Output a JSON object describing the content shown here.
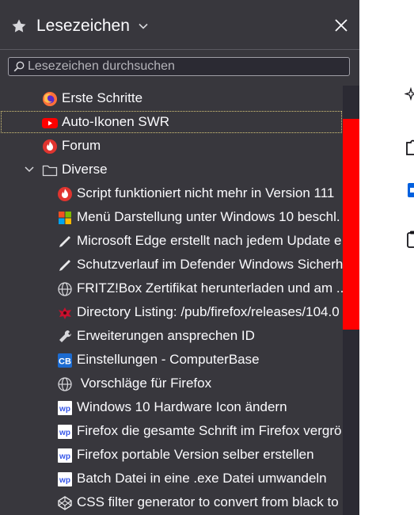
{
  "sidebar": {
    "title": "Lesezeichen",
    "search": {
      "placeholder": "Lesezeichen durchsuchen",
      "value": ""
    },
    "items": [
      {
        "label": "Erste Schritte",
        "icon": "firefox-icon"
      },
      {
        "label": "Auto-Ikonen  SWR",
        "icon": "youtube-icon",
        "selected": true
      },
      {
        "label": "Forum",
        "icon": "forum-flame-icon"
      },
      {
        "label": "Diverse",
        "icon": "folder-icon",
        "expanded": true
      },
      {
        "label": "Script funktioniert nicht mehr in Version 111",
        "icon": "forum-flame-icon"
      },
      {
        "label": "Menü Darstellung unter Windows 10 beschl.",
        "icon": "windows-logo-icon"
      },
      {
        "label": "Microsoft Edge erstellt nach jedem Update e",
        "icon": "pen-icon"
      },
      {
        "label": "Schutzverlauf im Defender Windows Sicherh",
        "icon": "pen-icon"
      },
      {
        "label": "FRITZ!Box Zertifikat herunterladen und am ..",
        "icon": "globe-icon"
      },
      {
        "label": "Directory Listing: /pub/firefox/releases/104.0",
        "icon": "dragon-icon"
      },
      {
        "label": "Erweiterungen ansprechen ID",
        "icon": "wrench-icon"
      },
      {
        "label": "Einstellungen - ComputerBase",
        "icon": "computerbase-icon"
      },
      {
        "label": " Vorschläge für Firefox",
        "icon": "globe-icon"
      },
      {
        "label": "Windows 10 Hardware Icon ändern",
        "icon": "wordpress-wp-icon"
      },
      {
        "label": "Firefox die gesamte Schrift im Firefox vergrö",
        "icon": "wordpress-wp-icon"
      },
      {
        "label": "Firefox portable Version selber erstellen",
        "icon": "wordpress-wp-icon"
      },
      {
        "label": "Batch Datei in eine .exe Datei umwandeln",
        "icon": "wordpress-wp-icon"
      },
      {
        "label": "CSS filter generator to convert from black to",
        "icon": "codepen-icon"
      }
    ]
  },
  "colors": {
    "sidebar_bg": "#38373d",
    "scroll_thumb": "#ff0000",
    "text": "#fbfbfe",
    "content_bg": "#ffffff"
  },
  "content": {
    "icons": [
      "sparkle-icon",
      "puzzle-icon",
      "blue-square-icon",
      "clipboard-icon"
    ]
  }
}
